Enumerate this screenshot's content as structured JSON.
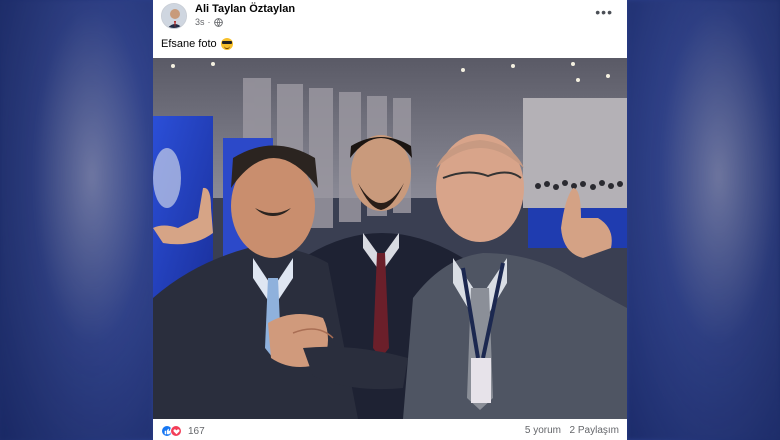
{
  "post": {
    "author": "Ali Taylan Öztaylan",
    "time": "3s",
    "text": "Efsane foto",
    "emoji_icon": "smiling-face-with-sunglasses-icon",
    "privacy_icon": "globe-icon",
    "menu_icon": "more-options-icon",
    "menu_label": "•••"
  },
  "footer": {
    "reaction_count": "167",
    "reaction_icons": [
      "like-icon",
      "love-icon"
    ],
    "comments": "5 yorum",
    "shares": "2 Paylaşım"
  },
  "colors": {
    "like": "#1877f2",
    "love": "#f33e58",
    "secondary_text": "#65676b",
    "background": "#2b3f8c"
  }
}
